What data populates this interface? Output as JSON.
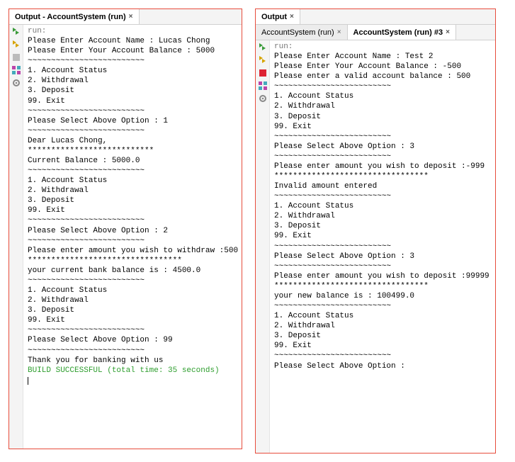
{
  "left": {
    "tab": {
      "label": "Output - AccountSystem (run)"
    },
    "gutter_icons": [
      "play-green-icon",
      "play-yellow-icon",
      "stop-icon",
      "grid-icon",
      "gear-icon"
    ],
    "lines": [
      {
        "t": "run:",
        "cls": "run-label"
      },
      {
        "t": "Please Enter Account Name : Lucas Chong"
      },
      {
        "t": "Please Enter Your Account Balance : 5000"
      },
      {
        "t": "~~~~~~~~~~~~~~~~~~~~~~~~~"
      },
      {
        "t": "1. Account Status"
      },
      {
        "t": "2. Withdrawal"
      },
      {
        "t": "3. Deposit"
      },
      {
        "t": "99. Exit"
      },
      {
        "t": "~~~~~~~~~~~~~~~~~~~~~~~~~"
      },
      {
        "t": ""
      },
      {
        "t": "Please Select Above Option : 1"
      },
      {
        "t": "~~~~~~~~~~~~~~~~~~~~~~~~~"
      },
      {
        "t": "Dear Lucas Chong,"
      },
      {
        "t": "***************************"
      },
      {
        "t": "Current Balance : 5000.0"
      },
      {
        "t": "~~~~~~~~~~~~~~~~~~~~~~~~~"
      },
      {
        "t": ""
      },
      {
        "t": "1. Account Status"
      },
      {
        "t": "2. Withdrawal"
      },
      {
        "t": "3. Deposit"
      },
      {
        "t": "99. Exit"
      },
      {
        "t": "~~~~~~~~~~~~~~~~~~~~~~~~~"
      },
      {
        "t": "Please Select Above Option : 2"
      },
      {
        "t": "~~~~~~~~~~~~~~~~~~~~~~~~~"
      },
      {
        "t": "Please enter amount you wish to withdraw :500"
      },
      {
        "t": "*********************************"
      },
      {
        "t": "your current bank balance is : 4500.0"
      },
      {
        "t": "~~~~~~~~~~~~~~~~~~~~~~~~~"
      },
      {
        "t": ""
      },
      {
        "t": "1. Account Status"
      },
      {
        "t": "2. Withdrawal"
      },
      {
        "t": "3. Deposit"
      },
      {
        "t": "99. Exit"
      },
      {
        "t": "~~~~~~~~~~~~~~~~~~~~~~~~~"
      },
      {
        "t": "Please Select Above Option : 99"
      },
      {
        "t": "~~~~~~~~~~~~~~~~~~~~~~~~~"
      },
      {
        "t": "Thank you for banking with us"
      },
      {
        "t": "BUILD SUCCESSFUL (total time: 35 seconds)",
        "cls": "success"
      }
    ]
  },
  "right": {
    "topTab": {
      "label": "Output"
    },
    "subTabs": [
      {
        "label": "AccountSystem (run)",
        "active": false
      },
      {
        "label": "AccountSystem (run) #3",
        "active": true
      }
    ],
    "gutter_icons": [
      "play-green-icon",
      "play-yellow-icon",
      "stop-red-icon",
      "grid-icon",
      "gear-icon"
    ],
    "lines": [
      {
        "t": "run:",
        "cls": "run-label"
      },
      {
        "t": "Please Enter Account Name : Test 2"
      },
      {
        "t": "Please Enter Your Account Balance : -500"
      },
      {
        "t": "Please enter a valid account balance : 500"
      },
      {
        "t": "~~~~~~~~~~~~~~~~~~~~~~~~~"
      },
      {
        "t": "1. Account Status"
      },
      {
        "t": "2. Withdrawal"
      },
      {
        "t": "3. Deposit"
      },
      {
        "t": "99. Exit"
      },
      {
        "t": "~~~~~~~~~~~~~~~~~~~~~~~~~"
      },
      {
        "t": ""
      },
      {
        "t": "Please Select Above Option : 3"
      },
      {
        "t": "~~~~~~~~~~~~~~~~~~~~~~~~~"
      },
      {
        "t": "Please enter amount you wish to deposit :-999"
      },
      {
        "t": "*********************************"
      },
      {
        "t": "Invalid amount entered"
      },
      {
        "t": "~~~~~~~~~~~~~~~~~~~~~~~~~"
      },
      {
        "t": ""
      },
      {
        "t": "1. Account Status"
      },
      {
        "t": "2. Withdrawal"
      },
      {
        "t": "3. Deposit"
      },
      {
        "t": "99. Exit"
      },
      {
        "t": "~~~~~~~~~~~~~~~~~~~~~~~~~"
      },
      {
        "t": "Please Select Above Option : 3"
      },
      {
        "t": "~~~~~~~~~~~~~~~~~~~~~~~~~"
      },
      {
        "t": "Please enter amount you wish to deposit :99999"
      },
      {
        "t": "*********************************"
      },
      {
        "t": "your new balance is : 100499.0"
      },
      {
        "t": "~~~~~~~~~~~~~~~~~~~~~~~~~"
      },
      {
        "t": ""
      },
      {
        "t": "1. Account Status"
      },
      {
        "t": "2. Withdrawal"
      },
      {
        "t": "3. Deposit"
      },
      {
        "t": "99. Exit"
      },
      {
        "t": "~~~~~~~~~~~~~~~~~~~~~~~~~"
      },
      {
        "t": "Please Select Above Option : "
      }
    ]
  }
}
